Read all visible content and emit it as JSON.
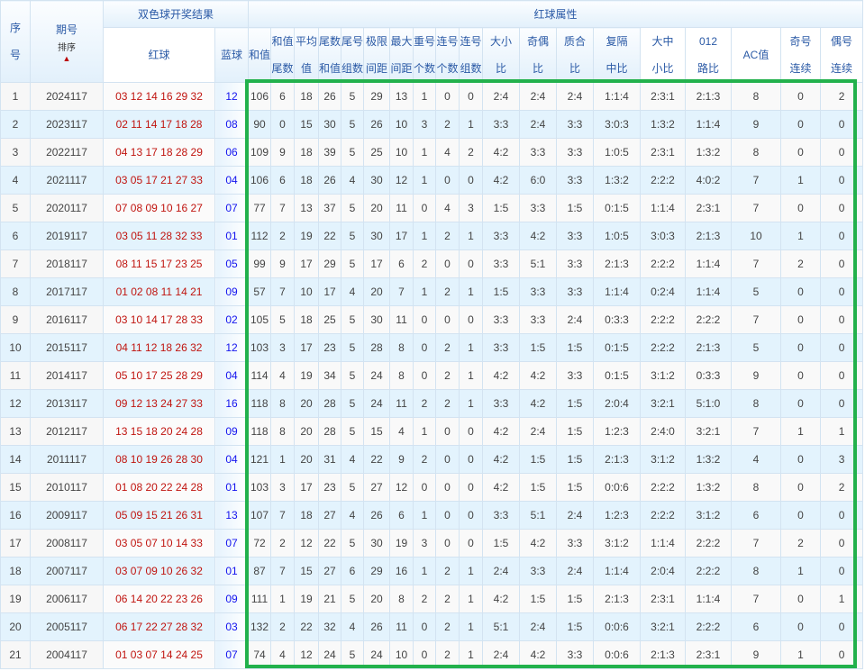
{
  "header": {
    "seq": [
      "序",
      "号"
    ],
    "issue": "期号",
    "sort": "排序",
    "result_group": "双色球开奖结果",
    "red": "红球",
    "blue": "蓝球",
    "attr_group": "红球属性",
    "attrs": [
      [
        "和值",
        ""
      ],
      [
        "和值",
        "尾数"
      ],
      [
        "平均",
        "值"
      ],
      [
        "尾数",
        "和值"
      ],
      [
        "尾号",
        "组数"
      ],
      [
        "极限",
        "间距"
      ],
      [
        "最大",
        "间距"
      ],
      [
        "重号",
        "个数"
      ],
      [
        "连号",
        "个数"
      ],
      [
        "连号",
        "组数"
      ],
      [
        "大小",
        "比"
      ],
      [
        "奇偶",
        "比"
      ],
      [
        "质合",
        "比"
      ],
      [
        "复隔",
        "中比"
      ],
      [
        "大中",
        "小比"
      ],
      [
        "012",
        "路比"
      ],
      [
        "AC值",
        ""
      ],
      [
        "奇号",
        "连续"
      ],
      [
        "偶号",
        "连续"
      ]
    ]
  },
  "colors": {
    "red_ball": "#c0140f",
    "blue_ball": "#1414ee",
    "highlight": "#22b14c"
  },
  "rows": [
    [
      "1",
      "2024117",
      "03 12 14 16 29 32",
      "12",
      "106",
      "6",
      "18",
      "26",
      "5",
      "29",
      "13",
      "1",
      "0",
      "0",
      "2:4",
      "2:4",
      "2:4",
      "1:1:4",
      "2:3:1",
      "2:1:3",
      "8",
      "0",
      "2"
    ],
    [
      "2",
      "2023117",
      "02 11 14 17 18 28",
      "08",
      "90",
      "0",
      "15",
      "30",
      "5",
      "26",
      "10",
      "3",
      "2",
      "1",
      "3:3",
      "2:4",
      "3:3",
      "3:0:3",
      "1:3:2",
      "1:1:4",
      "9",
      "0",
      "0"
    ],
    [
      "3",
      "2022117",
      "04 13 17 18 28 29",
      "06",
      "109",
      "9",
      "18",
      "39",
      "5",
      "25",
      "10",
      "1",
      "4",
      "2",
      "4:2",
      "3:3",
      "3:3",
      "1:0:5",
      "2:3:1",
      "1:3:2",
      "8",
      "0",
      "0"
    ],
    [
      "4",
      "2021117",
      "03 05 17 21 27 33",
      "04",
      "106",
      "6",
      "18",
      "26",
      "4",
      "30",
      "12",
      "1",
      "0",
      "0",
      "4:2",
      "6:0",
      "3:3",
      "1:3:2",
      "2:2:2",
      "4:0:2",
      "7",
      "1",
      "0"
    ],
    [
      "5",
      "2020117",
      "07 08 09 10 16 27",
      "07",
      "77",
      "7",
      "13",
      "37",
      "5",
      "20",
      "11",
      "0",
      "4",
      "3",
      "1:5",
      "3:3",
      "1:5",
      "0:1:5",
      "1:1:4",
      "2:3:1",
      "7",
      "0",
      "0"
    ],
    [
      "6",
      "2019117",
      "03 05 11 28 32 33",
      "01",
      "112",
      "2",
      "19",
      "22",
      "5",
      "30",
      "17",
      "1",
      "2",
      "1",
      "3:3",
      "4:2",
      "3:3",
      "1:0:5",
      "3:0:3",
      "2:1:3",
      "10",
      "1",
      "0"
    ],
    [
      "7",
      "2018117",
      "08 11 15 17 23 25",
      "05",
      "99",
      "9",
      "17",
      "29",
      "5",
      "17",
      "6",
      "2",
      "0",
      "0",
      "3:3",
      "5:1",
      "3:3",
      "2:1:3",
      "2:2:2",
      "1:1:4",
      "7",
      "2",
      "0"
    ],
    [
      "8",
      "2017117",
      "01 02 08 11 14 21",
      "09",
      "57",
      "7",
      "10",
      "17",
      "4",
      "20",
      "7",
      "1",
      "2",
      "1",
      "1:5",
      "3:3",
      "3:3",
      "1:1:4",
      "0:2:4",
      "1:1:4",
      "5",
      "0",
      "0"
    ],
    [
      "9",
      "2016117",
      "03 10 14 17 28 33",
      "02",
      "105",
      "5",
      "18",
      "25",
      "5",
      "30",
      "11",
      "0",
      "0",
      "0",
      "3:3",
      "3:3",
      "2:4",
      "0:3:3",
      "2:2:2",
      "2:2:2",
      "7",
      "0",
      "0"
    ],
    [
      "10",
      "2015117",
      "04 11 12 18 26 32",
      "12",
      "103",
      "3",
      "17",
      "23",
      "5",
      "28",
      "8",
      "0",
      "2",
      "1",
      "3:3",
      "1:5",
      "1:5",
      "0:1:5",
      "2:2:2",
      "2:1:3",
      "5",
      "0",
      "0"
    ],
    [
      "11",
      "2014117",
      "05 10 17 25 28 29",
      "04",
      "114",
      "4",
      "19",
      "34",
      "5",
      "24",
      "8",
      "0",
      "2",
      "1",
      "4:2",
      "4:2",
      "3:3",
      "0:1:5",
      "3:1:2",
      "0:3:3",
      "9",
      "0",
      "0"
    ],
    [
      "12",
      "2013117",
      "09 12 13 24 27 33",
      "16",
      "118",
      "8",
      "20",
      "28",
      "5",
      "24",
      "11",
      "2",
      "2",
      "1",
      "3:3",
      "4:2",
      "1:5",
      "2:0:4",
      "3:2:1",
      "5:1:0",
      "8",
      "0",
      "0"
    ],
    [
      "13",
      "2012117",
      "13 15 18 20 24 28",
      "09",
      "118",
      "8",
      "20",
      "28",
      "5",
      "15",
      "4",
      "1",
      "0",
      "0",
      "4:2",
      "2:4",
      "1:5",
      "1:2:3",
      "2:4:0",
      "3:2:1",
      "7",
      "1",
      "1"
    ],
    [
      "14",
      "2011117",
      "08 10 19 26 28 30",
      "04",
      "121",
      "1",
      "20",
      "31",
      "4",
      "22",
      "9",
      "2",
      "0",
      "0",
      "4:2",
      "1:5",
      "1:5",
      "2:1:3",
      "3:1:2",
      "1:3:2",
      "4",
      "0",
      "3"
    ],
    [
      "15",
      "2010117",
      "01 08 20 22 24 28",
      "01",
      "103",
      "3",
      "17",
      "23",
      "5",
      "27",
      "12",
      "0",
      "0",
      "0",
      "4:2",
      "1:5",
      "1:5",
      "0:0:6",
      "2:2:2",
      "1:3:2",
      "8",
      "0",
      "2"
    ],
    [
      "16",
      "2009117",
      "05 09 15 21 26 31",
      "13",
      "107",
      "7",
      "18",
      "27",
      "4",
      "26",
      "6",
      "1",
      "0",
      "0",
      "3:3",
      "5:1",
      "2:4",
      "1:2:3",
      "2:2:2",
      "3:1:2",
      "6",
      "0",
      "0"
    ],
    [
      "17",
      "2008117",
      "03 05 07 10 14 33",
      "07",
      "72",
      "2",
      "12",
      "22",
      "5",
      "30",
      "19",
      "3",
      "0",
      "0",
      "1:5",
      "4:2",
      "3:3",
      "3:1:2",
      "1:1:4",
      "2:2:2",
      "7",
      "2",
      "0"
    ],
    [
      "18",
      "2007117",
      "03 07 09 10 26 32",
      "01",
      "87",
      "7",
      "15",
      "27",
      "6",
      "29",
      "16",
      "1",
      "2",
      "1",
      "2:4",
      "3:3",
      "2:4",
      "1:1:4",
      "2:0:4",
      "2:2:2",
      "8",
      "1",
      "0"
    ],
    [
      "19",
      "2006117",
      "06 14 20 22 23 26",
      "09",
      "111",
      "1",
      "19",
      "21",
      "5",
      "20",
      "8",
      "2",
      "2",
      "1",
      "4:2",
      "1:5",
      "1:5",
      "2:1:3",
      "2:3:1",
      "1:1:4",
      "7",
      "0",
      "1"
    ],
    [
      "20",
      "2005117",
      "06 17 22 27 28 32",
      "03",
      "132",
      "2",
      "22",
      "32",
      "4",
      "26",
      "11",
      "0",
      "2",
      "1",
      "5:1",
      "2:4",
      "1:5",
      "0:0:6",
      "3:2:1",
      "2:2:2",
      "6",
      "0",
      "0"
    ],
    [
      "21",
      "2004117",
      "01 03 07 14 24 25",
      "07",
      "74",
      "4",
      "12",
      "24",
      "5",
      "24",
      "10",
      "0",
      "2",
      "1",
      "2:4",
      "4:2",
      "3:3",
      "0:0:6",
      "2:1:3",
      "2:3:1",
      "9",
      "1",
      "0"
    ]
  ]
}
